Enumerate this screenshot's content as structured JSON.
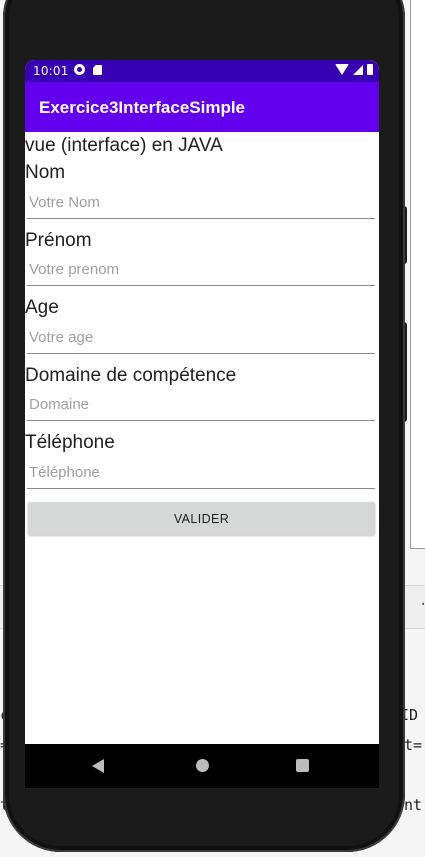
{
  "status_bar": {
    "time": "10:01"
  },
  "app_bar": {
    "title": "Exercice3InterfaceSimple"
  },
  "form": {
    "heading": "vue (interface) en JAVA",
    "nom": {
      "label": "Nom",
      "placeholder": "Votre Nom"
    },
    "prenom": {
      "label": "Prénom",
      "placeholder": "Votre prenom"
    },
    "age": {
      "label": "Age",
      "placeholder": "Votre age"
    },
    "domaine": {
      "label": "Domaine de compétence",
      "placeholder": "Domaine"
    },
    "telephone": {
      "label": "Téléphone",
      "placeholder": "Téléphone"
    },
    "submit_label": "VALIDER"
  },
  "ide_fragments": [
    "c",
    "=",
    "t",
    "DID",
    "nt=",
    "ent"
  ],
  "colors": {
    "status_bar": "#3700b3",
    "app_bar": "#6200ee",
    "button": "#d6d7d7"
  },
  "icons": [
    "wifi-icon",
    "signal-icon",
    "battery-icon",
    "back-icon",
    "home-icon",
    "recents-icon"
  ]
}
